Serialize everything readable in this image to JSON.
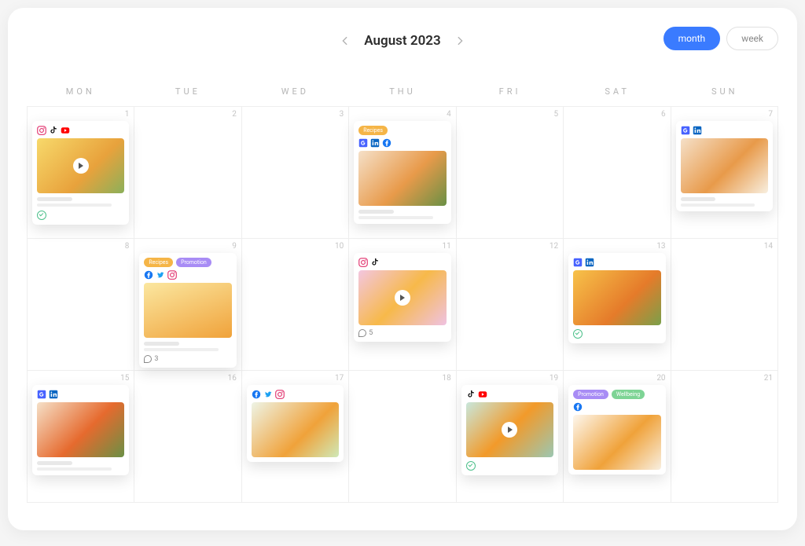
{
  "header": {
    "title": "August 2023",
    "view_toggle": {
      "month": "month",
      "week": "week",
      "active": "month"
    }
  },
  "daylabels": [
    "MON",
    "TUE",
    "WED",
    "THU",
    "FRI",
    "SAT",
    "SUN"
  ],
  "tags": {
    "recipes": "Recipes",
    "promotion": "Promotion",
    "wellbeing": "Wellbeing"
  },
  "networks": {
    "instagram": "instagram-icon",
    "tiktok": "tiktok-icon",
    "youtube": "youtube-icon",
    "google": "google-icon",
    "linkedin": "linkedin-icon",
    "facebook": "facebook-icon",
    "twitter": "twitter-icon"
  },
  "cells": [
    {
      "day": 1,
      "card": {
        "icons": [
          "instagram",
          "tiktok",
          "youtube"
        ],
        "thumb": "t1",
        "play": true,
        "skel": true,
        "check": true
      }
    },
    {
      "day": 2
    },
    {
      "day": 3
    },
    {
      "day": 4,
      "card": {
        "tags": [
          "recipes"
        ],
        "icons": [
          "google",
          "linkedin",
          "facebook"
        ],
        "thumb": "t2",
        "skel": true
      }
    },
    {
      "day": 5
    },
    {
      "day": 6
    },
    {
      "day": 7,
      "card": {
        "icons": [
          "google",
          "linkedin"
        ],
        "thumb": "t9",
        "skel": true
      }
    },
    {
      "day": 8
    },
    {
      "day": 9,
      "card": {
        "tags": [
          "recipes",
          "promotion"
        ],
        "icons": [
          "facebook",
          "twitter",
          "instagram"
        ],
        "thumb": "t3",
        "skel": true,
        "comments": 3
      }
    },
    {
      "day": 10
    },
    {
      "day": 11,
      "card": {
        "icons": [
          "instagram",
          "tiktok"
        ],
        "thumb": "t4",
        "play": true,
        "comments": 5
      }
    },
    {
      "day": 12
    },
    {
      "day": 13,
      "card": {
        "icons": [
          "google",
          "linkedin"
        ],
        "thumb": "t5",
        "check": true
      }
    },
    {
      "day": 14
    },
    {
      "day": 15,
      "card": {
        "icons": [
          "google",
          "linkedin"
        ],
        "thumb": "t10",
        "skel": true
      }
    },
    {
      "day": 16
    },
    {
      "day": 17,
      "card": {
        "icons": [
          "facebook",
          "twitter",
          "instagram"
        ],
        "thumb": "t6"
      }
    },
    {
      "day": 18
    },
    {
      "day": 19,
      "card": {
        "icons": [
          "tiktok",
          "youtube"
        ],
        "thumb": "t7",
        "play": true,
        "check": true
      }
    },
    {
      "day": 20,
      "card": {
        "tags": [
          "promotion",
          "wellbeing"
        ],
        "icons": [
          "facebook"
        ],
        "thumb": "t8"
      }
    },
    {
      "day": 21
    }
  ]
}
